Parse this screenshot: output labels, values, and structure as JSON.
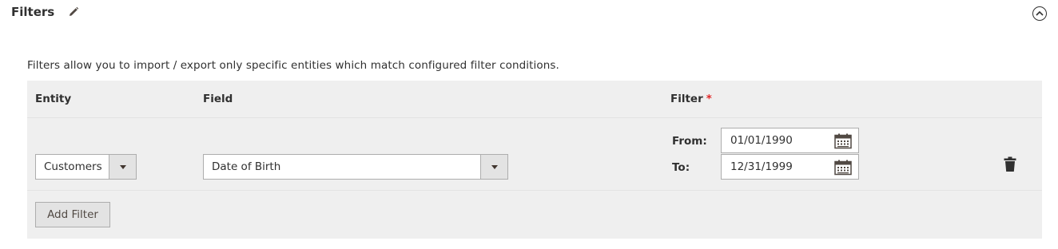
{
  "section": {
    "title": "Filters",
    "edit_icon": "pencil-icon",
    "collapse_icon": "chevron-up-circle-icon"
  },
  "description": "Filters allow you to import / export only specific entities which match configured filter conditions.",
  "grid": {
    "headers": {
      "entity": "Entity",
      "field": "Field",
      "filter": "Filter",
      "required_mark": "*"
    },
    "row": {
      "entity_value": "Customers",
      "field_value": "Date of Birth",
      "from_label": "From:",
      "from_value": "01/01/1990",
      "to_label": "To:",
      "to_value": "12/31/1999",
      "calendar_icon": "calendar-icon",
      "delete_icon": "trash-icon"
    },
    "add_filter_label": "Add Filter"
  },
  "colors": {
    "text": "#303030",
    "grid_bg": "#efefef",
    "required": "#e22626",
    "button_bg": "#e3e3e3"
  }
}
